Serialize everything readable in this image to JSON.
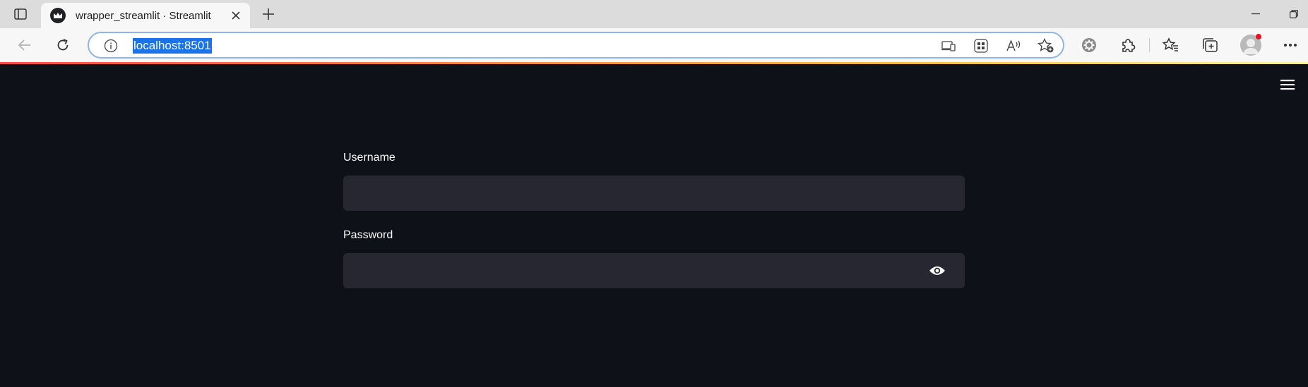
{
  "browser": {
    "tab": {
      "title": "wrapper_streamlit · Streamlit"
    },
    "address_bar": {
      "url": "localhost:8501"
    },
    "accent_color": "#1a73e8"
  },
  "icons": {
    "tab_actions": "tab-actions-icon",
    "favicon": "streamlit-crown-icon",
    "tab_close": "close-icon",
    "new_tab": "plus-icon",
    "minimize": "minimize-icon",
    "restore": "restore-icon",
    "back": "back-arrow-icon",
    "refresh": "refresh-icon",
    "site_info": "info-icon",
    "app_available": "app-available-icon",
    "apps": "apps-grid-icon",
    "read_aloud": "read-aloud-icon",
    "add_favorite": "star-add-icon",
    "extension_gear": "gear-icon",
    "extensions": "puzzle-icon",
    "favorites": "favorites-icon",
    "collections": "collections-icon",
    "profile": "profile-avatar-icon",
    "more": "more-icon",
    "main_menu": "hamburger-menu-icon",
    "show_password": "eye-icon"
  },
  "app": {
    "background": "#0e1117",
    "input_background": "#262730",
    "username": {
      "label": "Username",
      "value": ""
    },
    "password": {
      "label": "Password",
      "value": ""
    }
  }
}
